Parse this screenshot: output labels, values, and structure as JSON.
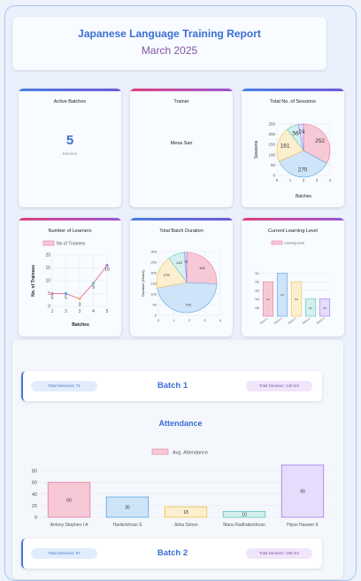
{
  "report": {
    "title": "Japanese Language Training Report",
    "subtitle": "March 2025"
  },
  "cards": {
    "active_batches": {
      "title": "Active Batches",
      "value": "5",
      "label": "Batches"
    },
    "trainer": {
      "title": "Trainer",
      "value": "Mesa San"
    },
    "sessions": {
      "title": "Total No. of Sessions"
    },
    "learners": {
      "title": "Number of Learners"
    },
    "duration": {
      "title": "Total Batch Duration"
    },
    "level": {
      "title": "Current Learning Level"
    }
  },
  "batches": [
    {
      "name": "Batch 1",
      "sessions": "Total Sessions: 71",
      "duration": "Total Duration: 140 hrs"
    },
    {
      "name": "Batch 2",
      "sessions": "Total Sessions: 87",
      "duration": "Total Duration: 186 hrs"
    }
  ],
  "attendance": {
    "title": "Attendance"
  },
  "colors": {
    "accent": "#3b6fd4",
    "purple": "#8355a8",
    "pink": "#f7c9d6",
    "pink_stroke": "#e77a9b",
    "blue": "#cfe4f8",
    "blue_stroke": "#5aa6e6",
    "yellow": "#fcefcf",
    "yellow_stroke": "#f0c050",
    "teal": "#d3f0ef",
    "teal_stroke": "#5cc4c2",
    "lavender": "#e6dcfb",
    "lavender_stroke": "#a07ae8"
  },
  "chart_data": [
    {
      "id": "sessions",
      "type": "pie",
      "title": "",
      "xlabel": "Batches",
      "ylabel": "Sessions",
      "xticks": [
        "0",
        "1",
        "2",
        "3",
        "4"
      ],
      "yticks": [
        "0",
        "50",
        "100",
        "150",
        "200",
        "250"
      ],
      "slices": [
        {
          "value": 252,
          "color": "#f7c9d6",
          "stroke": "#e77a9b"
        },
        {
          "value": 270,
          "color": "#cfe4f8",
          "stroke": "#5aa6e6"
        },
        {
          "value": 161,
          "color": "#fcefcf",
          "stroke": "#f0c050"
        },
        {
          "value": 56,
          "color": "#d3f0ef",
          "stroke": "#5cc4c2"
        },
        {
          "value": 24,
          "color": "#e6dcfb",
          "stroke": "#a07ae8"
        }
      ]
    },
    {
      "id": "learners",
      "type": "line",
      "title": "",
      "legend": [
        "No of Trainees"
      ],
      "xlabel": "Batches",
      "ylabel": "No. of Trainees",
      "x": [
        1,
        2,
        3,
        4,
        5
      ],
      "values": [
        5,
        5,
        3,
        9,
        16
      ],
      "ylim": [
        0,
        20
      ],
      "yticks": [
        "0",
        "5",
        "10",
        "15",
        "20"
      ]
    },
    {
      "id": "duration",
      "type": "pie",
      "title": "",
      "xlabel": "",
      "ylabel": "Duration (Hours)",
      "xticks": [
        "0",
        "1",
        "2",
        "3",
        "4"
      ],
      "yticks": [
        "0",
        "50",
        "100",
        "150",
        "200",
        "250",
        "300"
      ],
      "slices": [
        {
          "value": 402,
          "color": "#f7c9d6",
          "stroke": "#e77a9b"
        },
        {
          "value": 726,
          "color": "#cfe4f8",
          "stroke": "#5aa6e6"
        },
        {
          "value": 278,
          "color": "#fcefcf",
          "stroke": "#f0c050"
        },
        {
          "value": 140,
          "color": "#d3f0ef",
          "stroke": "#5cc4c2"
        },
        {
          "value": 18,
          "color": "#e6dcfb",
          "stroke": "#a07ae8"
        }
      ]
    },
    {
      "id": "level",
      "type": "bar",
      "title": "",
      "legend": [
        "Learning Level"
      ],
      "categories": [
        "Batch 1",
        "Batch 2",
        "Batch 3",
        "Batch 4",
        "Batch 5"
      ],
      "values": [
        4,
        5,
        4,
        2,
        2
      ],
      "data_labels": [
        "N4",
        "N3",
        "N4",
        "N5",
        "N5"
      ],
      "ylim": [
        0,
        7
      ],
      "yticks": [
        "N5",
        "N4",
        "N3",
        "N2",
        "N1"
      ]
    },
    {
      "id": "attendance",
      "type": "bar",
      "title": "",
      "legend": [
        "Avg. Attendance"
      ],
      "categories": [
        "Antony Stephen I A",
        "Harikrishnan S",
        "Jisha Simon",
        "Manu Radhakrishnan",
        "Hiyas Haseen K"
      ],
      "values": [
        60,
        35,
        18,
        10,
        90
      ],
      "ylim": [
        0,
        90
      ],
      "yticks": [
        "0",
        "20",
        "40",
        "60",
        "80"
      ]
    }
  ]
}
